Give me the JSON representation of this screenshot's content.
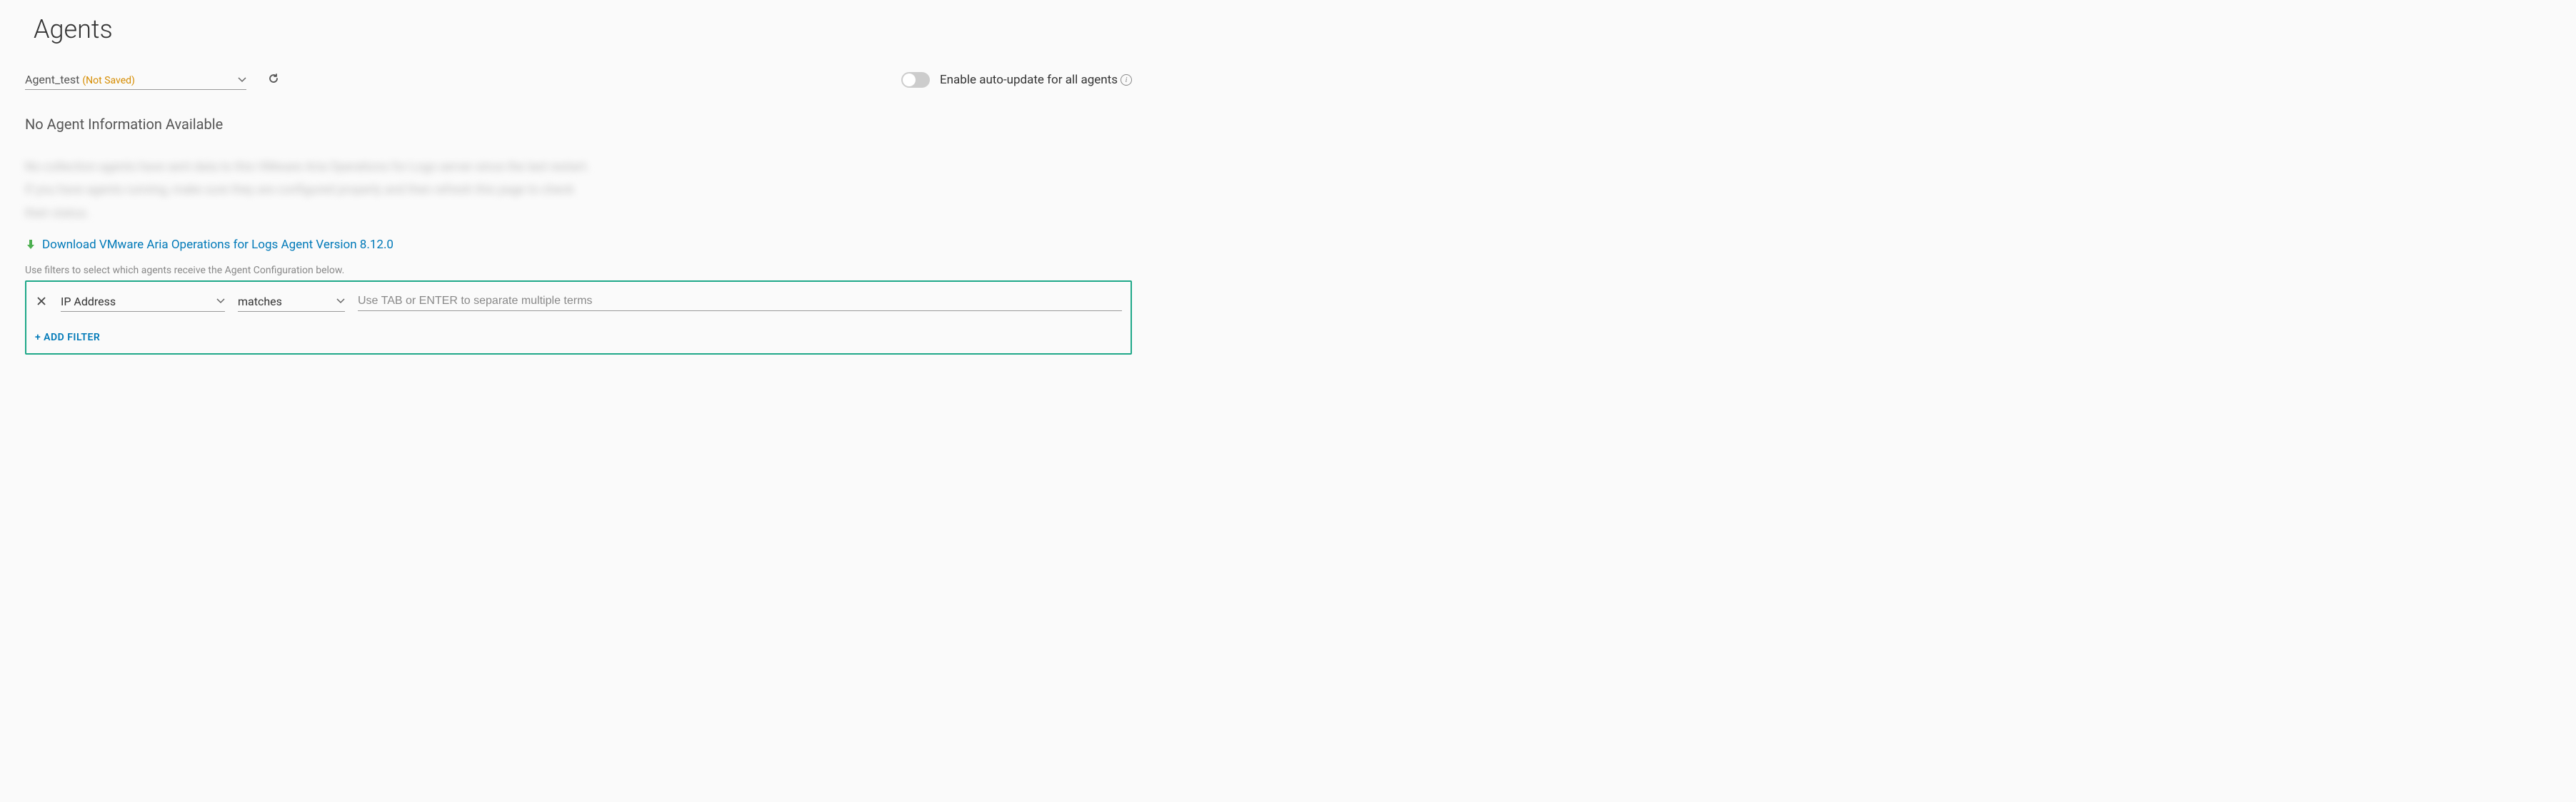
{
  "page_title": "Agents",
  "agent_select": {
    "name": "Agent_test",
    "status": "(Not Saved)"
  },
  "auto_update": {
    "label": "Enable auto-update for all agents",
    "enabled": false
  },
  "no_info_message": "No Agent Information Available",
  "blurred_placeholder": "No collection agents have sent data to this VMware Aria Operations for Logs server since the last restart. If you have agents running, make sure they are configured properly and then refresh this page to check their status.",
  "download": {
    "text": "Download VMware Aria Operations for Logs Agent Version 8.12.0"
  },
  "filter_hint": "Use filters to select which agents receive the Agent Configuration below.",
  "filter": {
    "field": "IP Address",
    "operator": "matches",
    "value": "",
    "placeholder": "Use TAB or ENTER to separate multiple terms"
  },
  "add_filter_label": "+ ADD FILTER"
}
